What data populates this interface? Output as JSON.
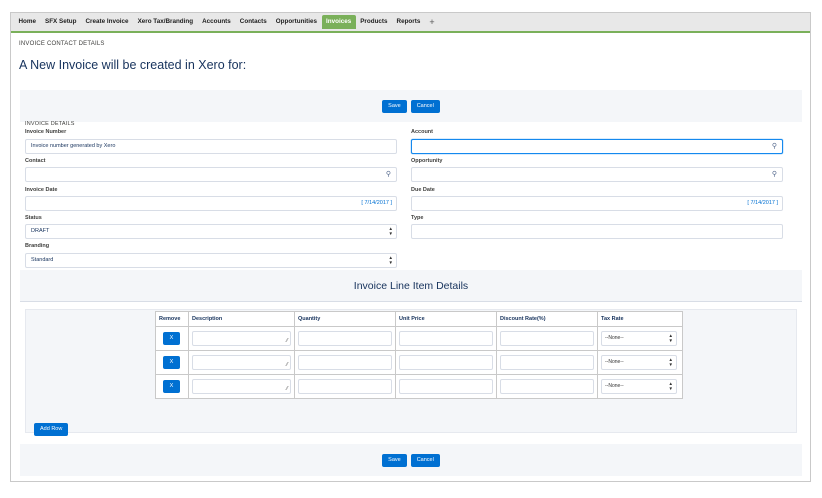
{
  "tabs": [
    "Home",
    "SFX Setup",
    "Create Invoice",
    "Xero Tax/Branding",
    "Accounts",
    "Contacts",
    "Opportunities",
    "Invoices",
    "Products",
    "Reports",
    "+"
  ],
  "active_tab": "Invoices",
  "breadcrumb": "INVOICE CONTACT DETAILS",
  "page_title": "A New Invoice will be created in Xero for:",
  "buttons": {
    "save": "Save",
    "cancel": "Cancel",
    "add_row": "Add Row",
    "remove": "X"
  },
  "section_label": "INVOICE DETAILS",
  "fields": {
    "invoice_number": {
      "label": "Invoice Number",
      "value": "Invoice number generated by Xero"
    },
    "account": {
      "label": "Account",
      "value": ""
    },
    "contact": {
      "label": "Contact",
      "value": ""
    },
    "opportunity": {
      "label": "Opportunity",
      "value": ""
    },
    "invoice_date": {
      "label": "Invoice Date",
      "link": "[ 7/14/2017 ]"
    },
    "due_date": {
      "label": "Due Date",
      "link": "[ 7/14/2017 ]"
    },
    "status": {
      "label": "Status",
      "value": "DRAFT"
    },
    "type": {
      "label": "Type",
      "value": ""
    },
    "branding": {
      "label": "Branding",
      "value": "Standard"
    }
  },
  "line_items": {
    "title": "Invoice Line Item Details",
    "columns": [
      "Remove",
      "Description",
      "Quantity",
      "Unit Price",
      "Discount Rate(%)",
      "Tax Rate"
    ],
    "rows": [
      {
        "tax_rate": "--None--"
      },
      {
        "tax_rate": "--None--"
      },
      {
        "tax_rate": "--None--"
      }
    ]
  },
  "icons": {
    "lookup": "search-icon",
    "spinner": "spinner-arrows-icon",
    "resize": "resize-handle-icon"
  }
}
